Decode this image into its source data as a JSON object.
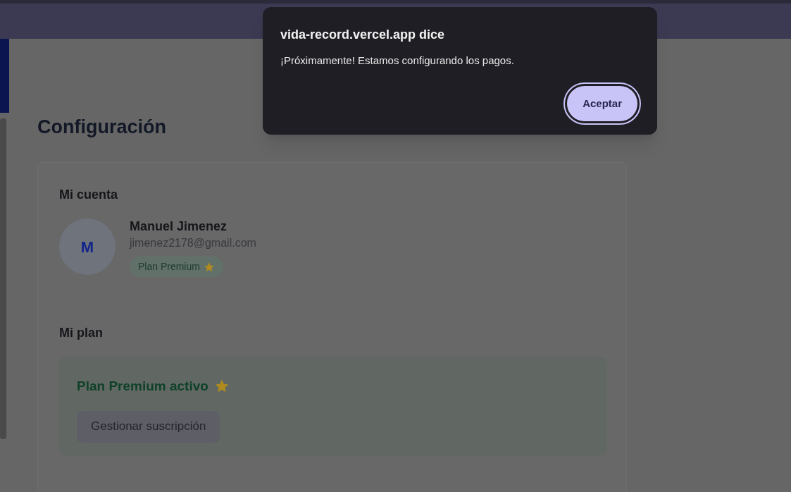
{
  "dialog": {
    "title": "vida-record.vercel.app dice",
    "message": "¡Próximamente! Estamos configurando los pagos.",
    "button": "Aceptar"
  },
  "page": {
    "title": "Configuración"
  },
  "account": {
    "heading": "Mi cuenta",
    "avatar_initial": "M",
    "name": "Manuel Jimenez",
    "email": "jimenez2178@gmail.com",
    "badge": "Plan Premium"
  },
  "plan": {
    "heading": "Mi plan",
    "status": "Plan Premium activo",
    "button": "Gestionar suscripción"
  }
}
